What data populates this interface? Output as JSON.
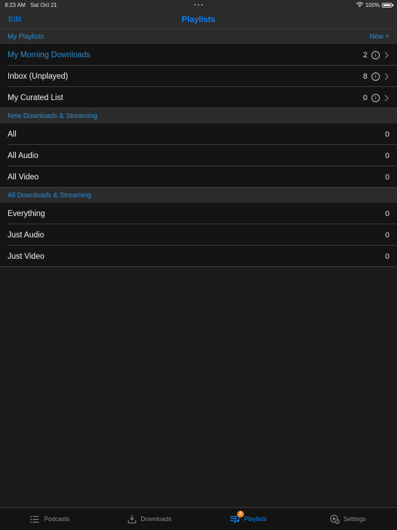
{
  "status_bar": {
    "time": "8:23 AM",
    "date": "Sat Oct 21",
    "center_indicator": "more-dots",
    "wifi_icon": "wifi-icon",
    "battery_percent": "100%",
    "battery_icon": "battery-full-icon"
  },
  "nav": {
    "edit_label": "Edit",
    "title": "Playlists"
  },
  "sections": [
    {
      "header": "My Playlists",
      "action": "New +",
      "rows": [
        {
          "label": "My Morning Downloads",
          "count": "2",
          "accent": true,
          "info": true,
          "chevron": true
        },
        {
          "label": "Inbox (Unplayed)",
          "count": "8",
          "accent": false,
          "info": true,
          "chevron": true
        },
        {
          "label": "My Curated List",
          "count": "0",
          "accent": false,
          "info": true,
          "chevron": true
        }
      ]
    },
    {
      "header": "New Downloads & Streaming",
      "action": "",
      "rows": [
        {
          "label": "All",
          "count": "0",
          "accent": false,
          "info": false,
          "chevron": false
        },
        {
          "label": "All Audio",
          "count": "0",
          "accent": false,
          "info": false,
          "chevron": false
        },
        {
          "label": "All Video",
          "count": "0",
          "accent": false,
          "info": false,
          "chevron": false
        }
      ]
    },
    {
      "header": "All Downloads & Streaming",
      "action": "",
      "rows": [
        {
          "label": "Everything",
          "count": "0",
          "accent": false,
          "info": false,
          "chevron": false
        },
        {
          "label": "Just Audio",
          "count": "0",
          "accent": false,
          "info": false,
          "chevron": false
        },
        {
          "label": "Just Video",
          "count": "0",
          "accent": false,
          "info": false,
          "chevron": false
        }
      ]
    }
  ],
  "tabs": [
    {
      "label": "Podcasts",
      "icon": "list-icon",
      "active": false,
      "badge": ""
    },
    {
      "label": "Downloads",
      "icon": "download-icon",
      "active": false,
      "badge": ""
    },
    {
      "label": "Playlists",
      "icon": "playlist-icon",
      "active": true,
      "badge": "2"
    },
    {
      "label": "Settings",
      "icon": "settings-icon",
      "active": false,
      "badge": ""
    }
  ],
  "colors": {
    "accent_blue": "#0a84ff",
    "section_blue": "#2a8fd8",
    "badge_orange": "#e8821a",
    "row_bg": "#141414",
    "header_bg": "#2b2b2b",
    "page_bg": "#1b1b1b"
  }
}
